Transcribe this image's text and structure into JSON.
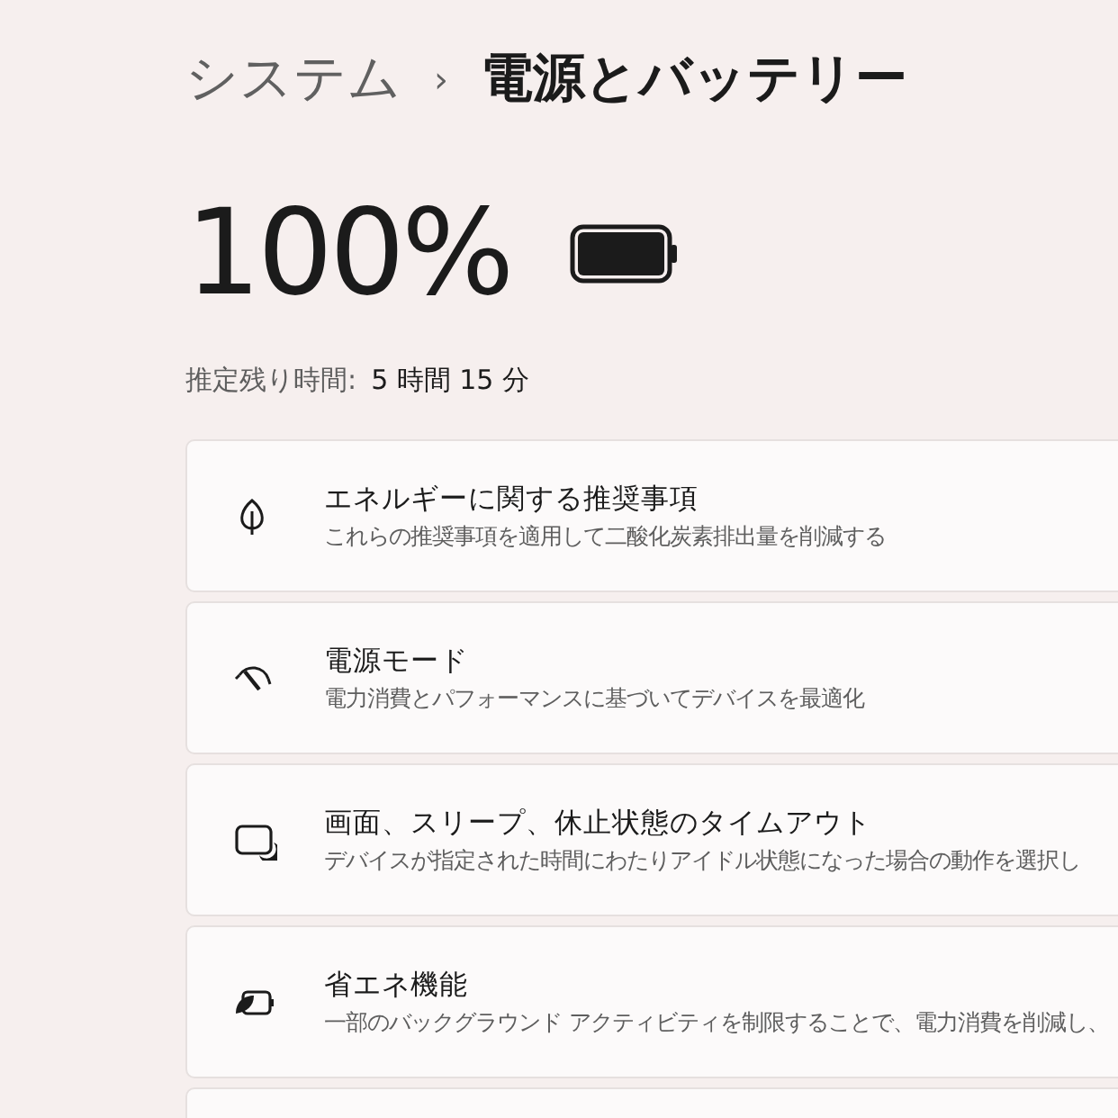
{
  "breadcrumb": {
    "parent": "システム",
    "separator": "›",
    "current": "電源とバッテリー"
  },
  "battery": {
    "percent": "100%",
    "level": 1
  },
  "estimate": {
    "label": "推定残り時間:",
    "value": "5 時間 15 分"
  },
  "cards": [
    {
      "kind": "leaf",
      "title": "エネルギーに関する推奨事項",
      "description": "これらの推奨事項を適用して二酸化炭素排出量を削減する"
    },
    {
      "kind": "gauge",
      "title": "電源モード",
      "description": "電力消費とパフォーマンスに基づいてデバイスを最適化"
    },
    {
      "kind": "screen",
      "title": "画面、スリープ、休止状態のタイムアウト",
      "description": "デバイスが指定された時間にわたりアイドル状態になった場合の動作を選択し"
    },
    {
      "kind": "saver",
      "title": "省エネ機能",
      "description": "一部のバックグラウンド アクティビティを制限することで、電力消費を削減し、"
    },
    {
      "kind": "partial"
    }
  ]
}
